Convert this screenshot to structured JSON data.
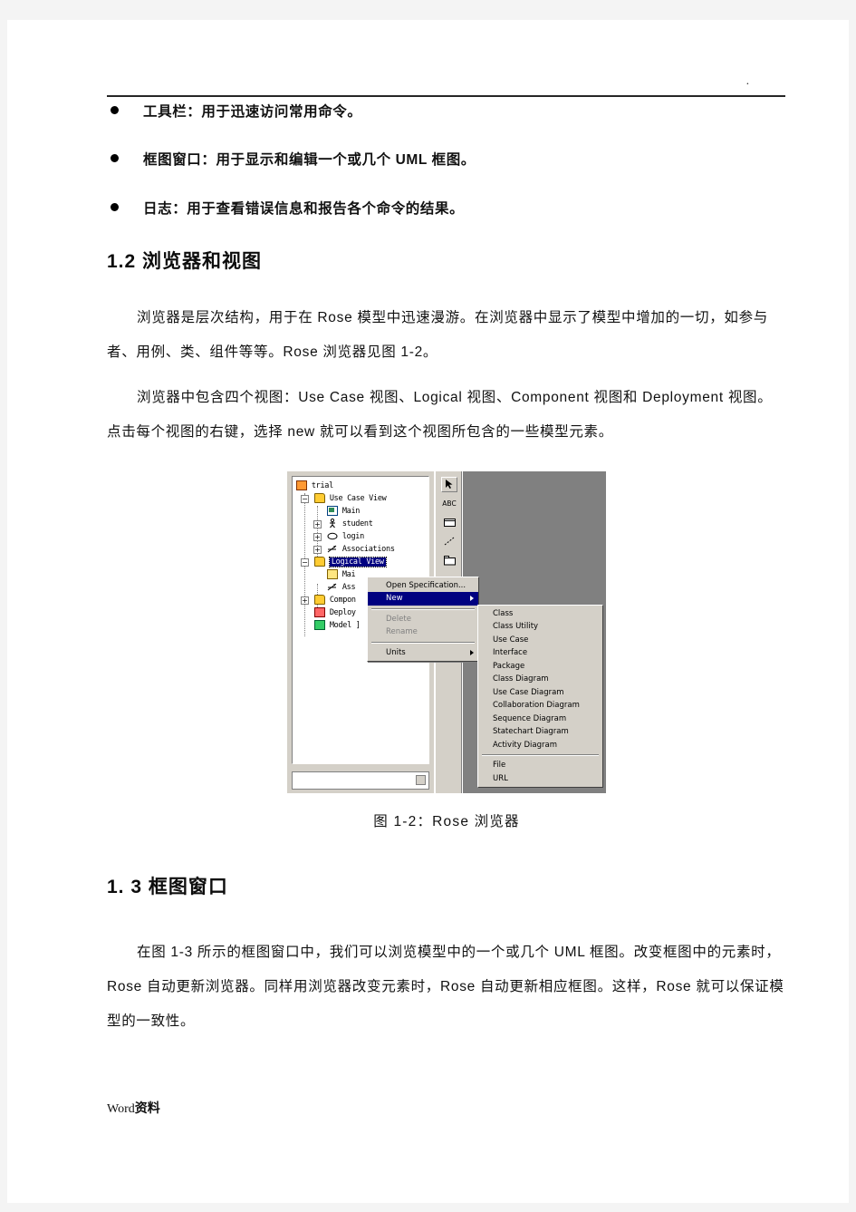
{
  "header": {
    "mark": "."
  },
  "bullets": [
    "工具栏：用于迅速访问常用命令。",
    "框图窗口：用于显示和编辑一个或几个 UML 框图。",
    "日志：用于查看错误信息和报告各个命令的结果。"
  ],
  "section_1_2": {
    "heading": "1.2 浏览器和视图",
    "paragraph_1": "浏览器是层次结构，用于在 Rose 模型中迅速漫游。在浏览器中显示了模型中增加的一切，如参与者、用例、类、组件等等。Rose 浏览器见图 1-2。",
    "paragraph_2": "浏览器中包含四个视图：Use Case 视图、Logical 视图、Component 视图和 Deployment 视图。点击每个视图的右键，选择 new 就可以看到这个视图所包含的一些模型元素。"
  },
  "figure": {
    "caption": "图 1-2：Rose 浏览器",
    "tree": {
      "nodes": [
        {
          "label": "trial",
          "icon": "model-icon",
          "indent": 0,
          "expander": "",
          "selected": false
        },
        {
          "label": "Use Case View",
          "icon": "folder-icon",
          "indent": 1,
          "expander": "-",
          "selected": false
        },
        {
          "label": "Main",
          "icon": "diagram-icon",
          "indent": 2,
          "expander": "",
          "selected": false
        },
        {
          "label": "student",
          "icon": "actor-icon",
          "indent": 2,
          "expander": "+",
          "selected": false
        },
        {
          "label": "login",
          "icon": "usecase-icon",
          "indent": 2,
          "expander": "+",
          "selected": false
        },
        {
          "label": "Associations",
          "icon": "association-icon",
          "indent": 2,
          "expander": "+",
          "selected": false
        },
        {
          "label": "Logical View",
          "icon": "folder-icon",
          "indent": 1,
          "expander": "-",
          "selected": true
        },
        {
          "label": "Mai",
          "icon": "class-diagram-icon",
          "indent": 2,
          "expander": "",
          "selected": false
        },
        {
          "label": "Ass",
          "icon": "association-icon",
          "indent": 2,
          "expander": "",
          "selected": false
        },
        {
          "label": "Compon",
          "icon": "folder-icon",
          "indent": 1,
          "expander": "+",
          "selected": false
        },
        {
          "label": "Deploy",
          "icon": "component-icon",
          "indent": 1,
          "expander": "",
          "selected": false
        },
        {
          "label": "Model ]",
          "icon": "model-properties-icon",
          "indent": 1,
          "expander": "",
          "selected": false
        }
      ]
    },
    "toolbar": {
      "buttons": [
        {
          "name": "selection-arrow-icon",
          "glyph": "➤",
          "pressed": true
        },
        {
          "name": "text-abc-icon",
          "glyph": "ABC",
          "pressed": false
        },
        {
          "name": "note-icon",
          "glyph": "⬜",
          "pressed": false
        },
        {
          "name": "anchor-note-line-icon",
          "glyph": "╱",
          "pressed": false
        },
        {
          "name": "package-icon",
          "glyph": "⬜",
          "pressed": false
        }
      ]
    },
    "context_menu": {
      "items": [
        {
          "label": "Open Specification...",
          "state": "normal",
          "submenu": false
        },
        {
          "label": "New",
          "state": "highlighted",
          "submenu": true
        },
        {
          "label": "Delete",
          "state": "disabled",
          "submenu": false
        },
        {
          "label": "Rename",
          "state": "disabled",
          "submenu": false
        },
        {
          "label": "Units",
          "state": "normal",
          "submenu": true
        }
      ]
    },
    "new_submenu": {
      "items": [
        "Class",
        "Class Utility",
        "Use Case",
        "Interface",
        "Package",
        "Class Diagram",
        "Use Case Diagram",
        "Collaboration Diagram",
        "Sequence Diagram",
        "Statechart Diagram",
        "Activity Diagram"
      ],
      "items_after_separator": [
        "File",
        "URL"
      ]
    }
  },
  "section_1_3": {
    "heading": "1. 3 框图窗口",
    "paragraph_1": "在图 1-3 所示的框图窗口中，我们可以浏览模型中的一个或几个 UML 框图。改变框图中的元素时，Rose 自动更新浏览器。同样用浏览器改变元素时，Rose 自动更新相应框图。这样，Rose 就可以保证模型的一致性。"
  },
  "footer": {
    "prefix": "Word",
    "suffix": "资料"
  },
  "colors": {
    "menu_face": "#d4d0c8",
    "menu_highlight": "#000080",
    "canvas_gray": "#808080",
    "folder_yellow": "#ffcc33",
    "page_background": "#ffffff"
  }
}
